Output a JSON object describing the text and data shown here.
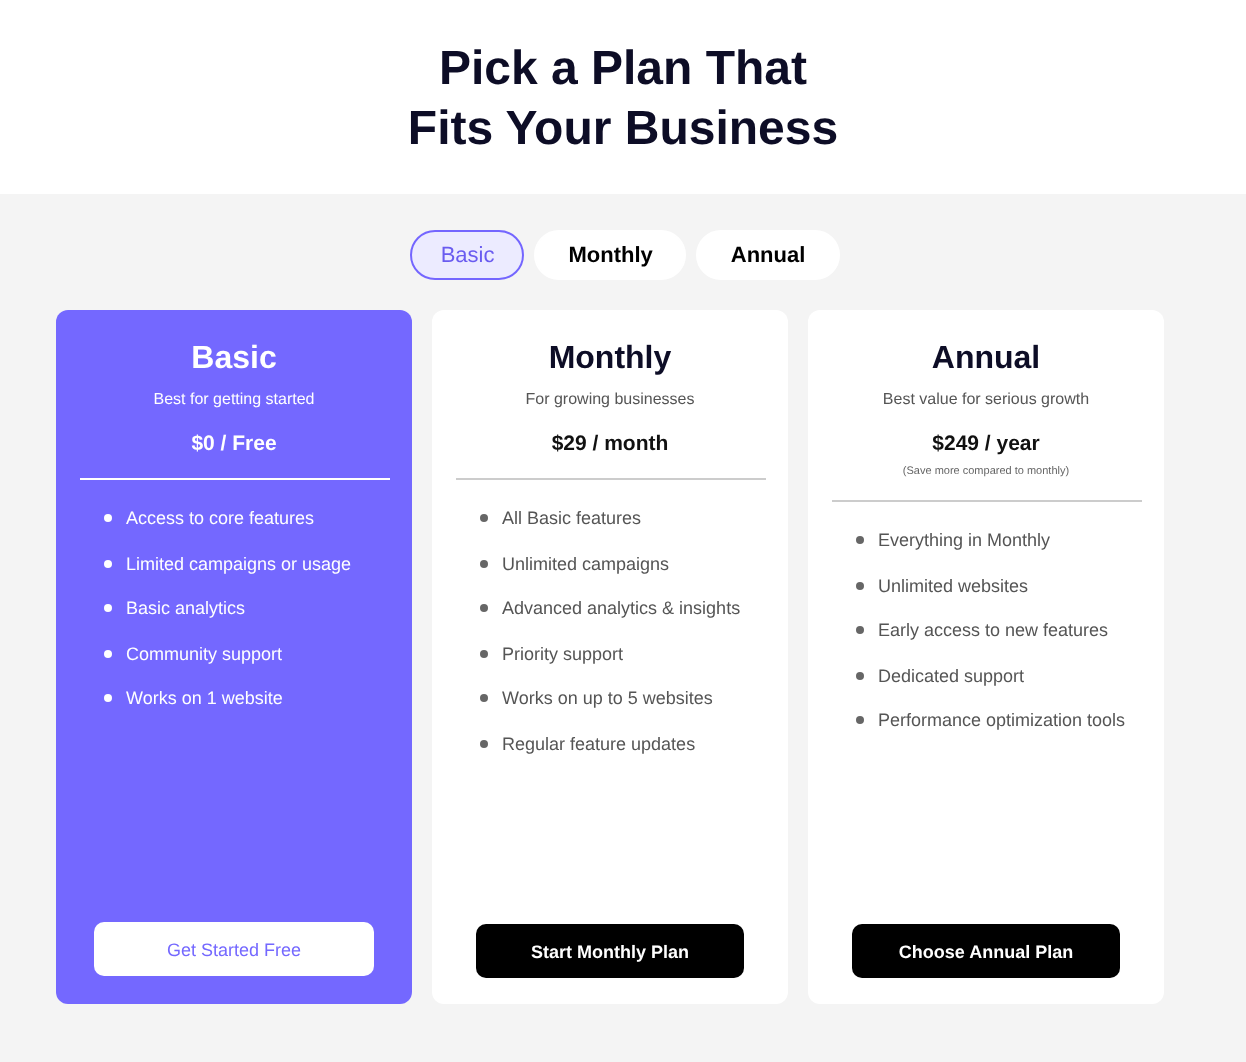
{
  "heading": [
    "Pick a Plan That",
    "Fits Your Business"
  ],
  "tabs": [
    {
      "label": "Basic",
      "selected": true
    },
    {
      "label": "Monthly",
      "selected": false
    },
    {
      "label": "Annual",
      "selected": false
    }
  ],
  "plans": [
    {
      "name": "Basic",
      "tagline": "Best for getting started",
      "price": "$0 / Free",
      "selected": true,
      "features": [
        "Access to core features",
        "Limited campaigns or usage",
        "Basic analytics",
        "Community support",
        "Works on 1 website"
      ],
      "button": "Get Started Free"
    },
    {
      "name": "Monthly",
      "tagline": "For growing businesses",
      "price": "$29 / month",
      "selected": false,
      "features": [
        "All Basic features",
        "Unlimited campaigns",
        "Advanced analytics & insights",
        "Priority support",
        "Works on up to 5 websites",
        "Regular feature updates"
      ],
      "button": "Start Monthly Plan"
    },
    {
      "name": "Annual",
      "tagline": "Best value for serious growth",
      "price": "$249 / year",
      "note": "(Save more compared to monthly)",
      "selected": false,
      "features": [
        "Everything in Monthly",
        "Unlimited websites",
        "Early access to new features",
        "Dedicated support",
        "Performance optimization tools"
      ],
      "button": "Choose Annual Plan"
    }
  ]
}
